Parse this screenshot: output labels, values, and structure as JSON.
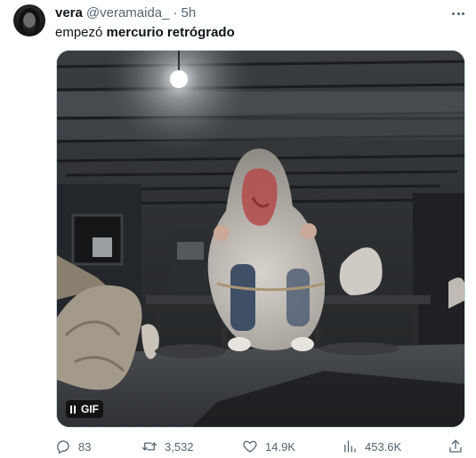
{
  "tweet": {
    "author": {
      "name": "vera",
      "handle": "@veramaida_",
      "separator": "·",
      "time": "5h"
    },
    "text": {
      "prefix": "empezó ",
      "bold": "mercurio retrógrado"
    },
    "media": {
      "badge": "GIF",
      "description": "gif"
    },
    "stats": {
      "replies": "83",
      "retweets": "3,532",
      "likes": "14.9K",
      "views": "453.6K"
    }
  },
  "icons": {
    "more": "more-dots-icon",
    "reply": "reply-bubble-icon",
    "retweet": "retweet-arrows-icon",
    "like": "heart-icon",
    "views": "bar-chart-icon",
    "share": "share-upload-icon"
  },
  "colors": {
    "text": "#0f1419",
    "secondary": "#536471",
    "border": "#cfd9de"
  }
}
